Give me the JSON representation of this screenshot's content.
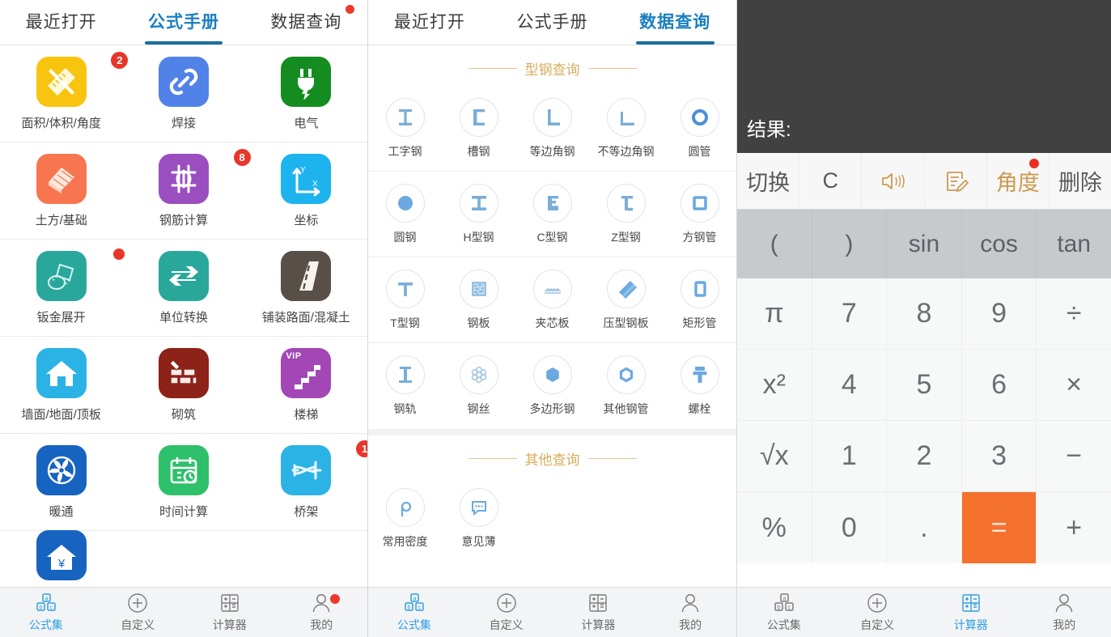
{
  "panel1": {
    "tabs": [
      {
        "label": "最近打开",
        "active": false,
        "dot": false
      },
      {
        "label": "公式手册",
        "active": true,
        "dot": false
      },
      {
        "label": "数据查询",
        "active": false,
        "dot": true
      }
    ],
    "tiles": [
      [
        {
          "label": "面积/体积/角度",
          "icon": "ruler-pencil-icon",
          "color": "#f8c410",
          "badge": "2"
        },
        {
          "label": "焊接",
          "icon": "link-chain-icon",
          "color": "#5182e8",
          "badge": ""
        },
        {
          "label": "电气",
          "icon": "plug-bolt-icon",
          "color": "#148c1f",
          "badge": ""
        }
      ],
      [
        {
          "label": "土方/基础",
          "icon": "earthwork-icon",
          "color": "#f8764f",
          "badge": ""
        },
        {
          "label": "钢筋计算",
          "icon": "rebar-icon",
          "color": "#9b4ec0",
          "badge": "8"
        },
        {
          "label": "坐标",
          "icon": "axes-xy-icon",
          "color": "#1cb3ef",
          "badge": ""
        }
      ],
      [
        {
          "label": "钣金展开",
          "icon": "sheetmetal-icon",
          "color": "#2aa79b",
          "badge": "dot"
        },
        {
          "label": "单位转换",
          "icon": "convert-arrows-icon",
          "color": "#2aa79b",
          "badge": ""
        },
        {
          "label": "铺装路面/混凝土",
          "icon": "road-icon",
          "color": "#585048",
          "badge": ""
        }
      ],
      [
        {
          "label": "墙面/地面/顶板",
          "icon": "house-icon",
          "color": "#2cb3e5",
          "badge": ""
        },
        {
          "label": "砌筑",
          "icon": "brickwork-icon",
          "color": "#8d2218",
          "badge": ""
        },
        {
          "label": "楼梯",
          "icon": "stairs-icon",
          "color": "#a247b5",
          "badge": "",
          "vip": "VIP"
        }
      ],
      [
        {
          "label": "暖通",
          "icon": "fan-icon",
          "color": "#1763c0",
          "badge": ""
        },
        {
          "label": "时间计算",
          "icon": "calendar-clock-icon",
          "color": "#2ec06a",
          "badge": ""
        },
        {
          "label": "桥架",
          "icon": "cable-tray-icon",
          "color": "#2cb3e5",
          "badge": "1"
        }
      ],
      [
        {
          "label": "",
          "icon": "house-yuan-icon",
          "color": "#1763c0",
          "badge": ""
        },
        {
          "label": "",
          "icon": "",
          "color": "",
          "badge": ""
        },
        {
          "label": "",
          "icon": "",
          "color": "",
          "badge": ""
        }
      ]
    ],
    "nav": [
      {
        "label": "公式集",
        "icon": "abc-blocks-icon",
        "active": true,
        "dot": false
      },
      {
        "label": "自定义",
        "icon": "plus-circle-icon",
        "active": false,
        "dot": false
      },
      {
        "label": "计算器",
        "icon": "calculator-grid-icon",
        "active": false,
        "dot": false
      },
      {
        "label": "我的",
        "icon": "person-icon",
        "active": false,
        "dot": true
      }
    ]
  },
  "panel2": {
    "tabs": [
      {
        "label": "最近打开",
        "active": false
      },
      {
        "label": "公式手册",
        "active": false
      },
      {
        "label": "数据查询",
        "active": true
      }
    ],
    "section1_title": "型钢查询",
    "section1_rows": [
      [
        {
          "label": "工字钢",
          "icon": "i-beam-icon"
        },
        {
          "label": "槽钢",
          "icon": "channel-steel-icon"
        },
        {
          "label": "等边角钢",
          "icon": "equal-angle-icon"
        },
        {
          "label": "不等边角钢",
          "icon": "unequal-angle-icon"
        },
        {
          "label": "圆管",
          "icon": "round-pipe-icon"
        }
      ],
      [
        {
          "label": "圆钢",
          "icon": "round-bar-icon"
        },
        {
          "label": "H型钢",
          "icon": "h-beam-icon"
        },
        {
          "label": "C型钢",
          "icon": "c-section-icon"
        },
        {
          "label": "Z型钢",
          "icon": "z-section-icon"
        },
        {
          "label": "方钢管",
          "icon": "square-tube-icon"
        }
      ],
      [
        {
          "label": "T型钢",
          "icon": "t-section-icon"
        },
        {
          "label": "钢板",
          "icon": "steel-plate-icon"
        },
        {
          "label": "夹芯板",
          "icon": "sandwich-panel-icon"
        },
        {
          "label": "压型钢板",
          "icon": "profiled-sheet-icon"
        },
        {
          "label": "矩形管",
          "icon": "rect-tube-icon"
        }
      ],
      [
        {
          "label": "钢轨",
          "icon": "rail-icon"
        },
        {
          "label": "钢丝",
          "icon": "steel-wire-icon"
        },
        {
          "label": "多边形钢",
          "icon": "polygon-steel-icon"
        },
        {
          "label": "其他钢管",
          "icon": "other-pipe-icon"
        },
        {
          "label": "螺栓",
          "icon": "bolt-icon"
        }
      ]
    ],
    "section2_title": "其他查询",
    "section2_rows": [
      [
        {
          "label": "常用密度",
          "icon": "rho-density-icon"
        },
        {
          "label": "意见薄",
          "icon": "feedback-icon"
        }
      ]
    ],
    "nav": [
      {
        "label": "公式集",
        "icon": "abc-blocks-icon",
        "active": true
      },
      {
        "label": "自定义",
        "icon": "plus-circle-icon",
        "active": false
      },
      {
        "label": "计算器",
        "icon": "calculator-grid-icon",
        "active": false
      },
      {
        "label": "我的",
        "icon": "person-icon",
        "active": false
      }
    ]
  },
  "panel3": {
    "display": {
      "result_label": "结果:",
      "expression": ""
    },
    "toolbar": [
      {
        "label": "切换",
        "icon": "",
        "style": "text",
        "dot": false
      },
      {
        "label": "C",
        "icon": "",
        "style": "text",
        "dot": false
      },
      {
        "label": "",
        "icon": "speaker-sound-icon",
        "style": "gold",
        "dot": false
      },
      {
        "label": "",
        "icon": "note-edit-icon",
        "style": "gold",
        "dot": false
      },
      {
        "label": "角度",
        "icon": "",
        "style": "gold",
        "dot": true
      },
      {
        "label": "删除",
        "icon": "",
        "style": "text",
        "dot": false
      }
    ],
    "func_keys": [
      "(",
      ")",
      "sin",
      "cos",
      "tan"
    ],
    "keypad": [
      [
        "π",
        "7",
        "8",
        "9",
        "÷"
      ],
      [
        "x²",
        "4",
        "5",
        "6",
        "×"
      ],
      [
        "√x",
        "1",
        "2",
        "3",
        "−"
      ],
      [
        "%",
        "0",
        ".",
        "=",
        "+"
      ]
    ],
    "equals_key": "=",
    "accent_orange": "#f4712e",
    "nav": [
      {
        "label": "公式集",
        "icon": "abc-blocks-icon",
        "active": false
      },
      {
        "label": "自定义",
        "icon": "plus-circle-icon",
        "active": false
      },
      {
        "label": "计算器",
        "icon": "calculator-grid-icon",
        "active": true
      },
      {
        "label": "我的",
        "icon": "person-icon",
        "active": false
      }
    ]
  }
}
